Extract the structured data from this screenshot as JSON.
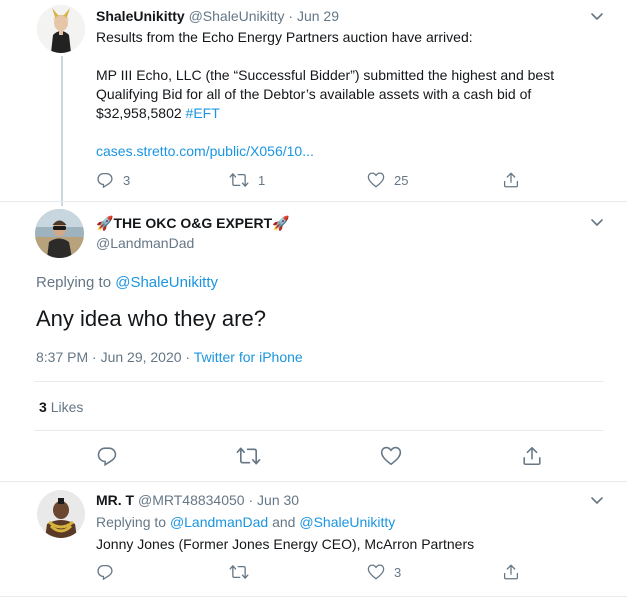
{
  "tweet1": {
    "display_name": "ShaleUnikitty",
    "handle": "@ShaleUnikitty",
    "sep": "·",
    "date": "Jun 29",
    "line1": "Results from the Echo Energy Partners auction have arrived:",
    "line2": "MP III Echo, LLC (the “Successful Bidder”) submitted the highest and best",
    "line3": "Qualifying Bid for all of the Debtor’s available assets with a cash bid of",
    "line4_amount": "$32,958,5802",
    "hashtag": "#EFT",
    "link": "cases.stretto.com/public/X056/10...",
    "replies": "3",
    "retweets": "1",
    "likes": "25"
  },
  "tweet2": {
    "rocket": "🚀",
    "display_name": "THE OKC O&G EXPERT",
    "handle": "@LandmanDad",
    "replying_prefix": "Replying to",
    "replying_to": "@ShaleUnikitty",
    "text": "Any idea who they are?",
    "timestamp": "8:37 PM · Jun 29, 2020 ·",
    "source": "Twitter for iPhone",
    "likes_count": "3",
    "likes_label": "Likes"
  },
  "tweet3": {
    "display_name": "MR. T",
    "handle": "@MRT48834050",
    "sep": "·",
    "date": "Jun 30",
    "replying_prefix": "Replying to",
    "replying_to_1": "@LandmanDad",
    "and": "and",
    "replying_to_2": "@ShaleUnikitty",
    "text": "Jonny Jones (Former Jones Energy CEO), McArron Partners",
    "replies": "",
    "retweets": "",
    "likes": "3"
  },
  "colors": {
    "accent": "#1b95e0",
    "muted": "#657786",
    "border": "#e6ecf0",
    "text": "#14171a"
  },
  "icons": [
    "reply-icon",
    "retweet-icon",
    "like-icon",
    "share-icon",
    "chevron-down-icon"
  ]
}
